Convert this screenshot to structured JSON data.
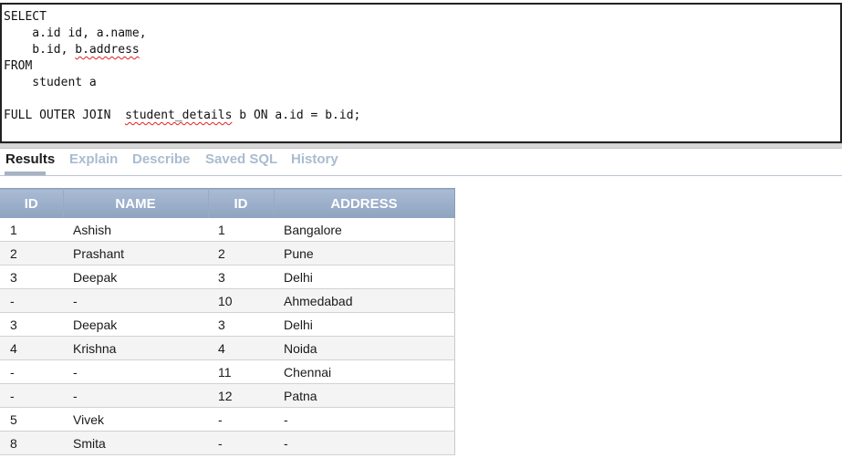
{
  "editor": {
    "sql_lines": [
      "SELECT",
      "    a.id id, a.name,",
      "    b.id, b.address",
      "FROM",
      "    student a",
      "",
      "FULL OUTER JOIN  student_details b ON a.id = b.id;"
    ]
  },
  "tabs": [
    {
      "label": "Results",
      "active": true
    },
    {
      "label": "Explain",
      "active": false
    },
    {
      "label": "Describe",
      "active": false
    },
    {
      "label": "Saved SQL",
      "active": false
    },
    {
      "label": "History",
      "active": false
    }
  ],
  "results": {
    "columns": [
      "ID",
      "NAME",
      "ID",
      "ADDRESS"
    ],
    "rows": [
      [
        "1",
        "Ashish",
        "1",
        "Bangalore"
      ],
      [
        "2",
        "Prashant",
        "2",
        "Pune"
      ],
      [
        "3",
        "Deepak",
        "3",
        "Delhi"
      ],
      [
        "-",
        "-",
        "10",
        "Ahmedabad"
      ],
      [
        "3",
        "Deepak",
        "3",
        "Delhi"
      ],
      [
        "4",
        "Krishna",
        "4",
        "Noida"
      ],
      [
        "-",
        "-",
        "11",
        "Chennai"
      ],
      [
        "-",
        "-",
        "12",
        "Patna"
      ],
      [
        "5",
        "Vivek",
        "-",
        "-"
      ],
      [
        "8",
        "Smita",
        "-",
        "-"
      ]
    ]
  },
  "colors": {
    "header_bg": "#9aadc8",
    "tab_inactive": "#a9bccf",
    "tab_active": "#1c1c1c",
    "spellcheck": "#e02020"
  }
}
